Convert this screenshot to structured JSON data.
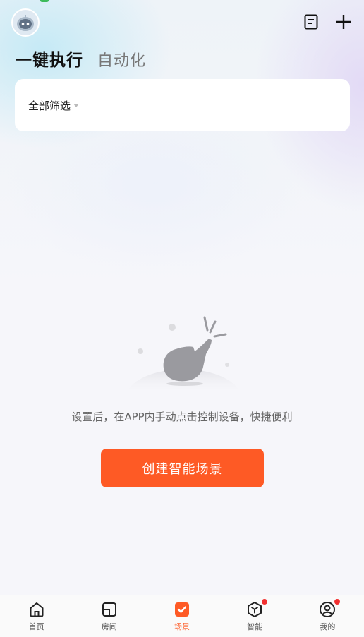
{
  "header": {
    "tabs": [
      {
        "label": "一键执行",
        "active": true
      },
      {
        "label": "自动化",
        "active": false
      }
    ],
    "icons": [
      "robot-avatar",
      "log-icon",
      "add-icon"
    ]
  },
  "filter": {
    "label": "全部筛选"
  },
  "empty_state": {
    "message": "设置后，在APP内手动点击控制设备，快捷便利",
    "button_label": "创建智能场景"
  },
  "bottom_nav": {
    "items": [
      {
        "label": "首页",
        "icon": "home-icon",
        "active": false,
        "badge": false
      },
      {
        "label": "房间",
        "icon": "room-icon",
        "active": false,
        "badge": false
      },
      {
        "label": "场景",
        "icon": "scene-icon",
        "active": true,
        "badge": false
      },
      {
        "label": "智能",
        "icon": "smart-icon",
        "active": false,
        "badge": true
      },
      {
        "label": "我的",
        "icon": "profile-icon",
        "active": false,
        "badge": true
      }
    ]
  },
  "colors": {
    "accent": "#fe5a25",
    "badge": "#f23030"
  }
}
